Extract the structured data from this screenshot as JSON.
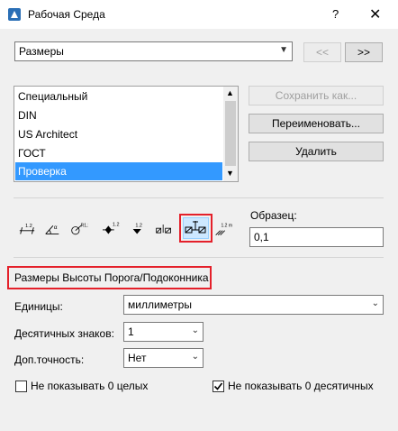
{
  "window": {
    "title": "Рабочая Среда",
    "help": "?",
    "close": "✕"
  },
  "scheme": {
    "selected": "Размеры",
    "prev": "<<",
    "next": ">>"
  },
  "list": {
    "items": [
      "Специальный",
      "DIN",
      "US Architect",
      "ГОСТ",
      "Проверка"
    ],
    "selected_index": 4
  },
  "actions": {
    "save_as": "Сохранить как...",
    "rename": "Переименовать...",
    "delete": "Удалить"
  },
  "dimension_types": {
    "icons": [
      "linear-dimension-icon",
      "angle-dimension-icon",
      "radial-dimension-icon",
      "level-dimension-icon",
      "elevation-dimension-icon",
      "door-window-dimension-icon",
      "sill-height-dimension-icon",
      "area-dimension-icon"
    ],
    "selected_index": 6,
    "labels": [
      "1.2",
      "α",
      "R1.2",
      "1.2",
      "1.2",
      "",
      "",
      "1.2 m²"
    ]
  },
  "sample": {
    "label": "Образец:",
    "value": "0,1"
  },
  "section_title": "Размеры Высоты Порога/Подоконника",
  "units": {
    "label": "Единицы:",
    "value": "миллиметры"
  },
  "decimals": {
    "label": "Десятичных знаков:",
    "value": "1"
  },
  "extra_precision": {
    "label": "Доп.точность:",
    "value": "Нет"
  },
  "options": {
    "hide_whole_zero": {
      "label": "Не показывать 0 целых",
      "checked": false
    },
    "hide_decimal_zeros": {
      "label": "Не показывать 0 десятичных",
      "checked": true
    }
  },
  "colors": {
    "highlight": "#e4202a",
    "selection": "#3399ff"
  }
}
